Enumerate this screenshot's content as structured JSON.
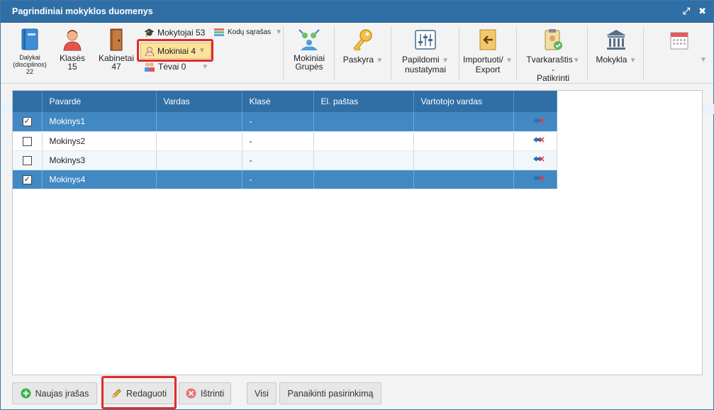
{
  "window": {
    "title": "Pagrindiniai mokyklos duomenys",
    "icons": [
      "resize-icon",
      "close-icon"
    ],
    "resize_glyph": "⤢",
    "close_glyph": "✖"
  },
  "ribbon": {
    "dalykai": {
      "label": "Dalykai (disciplinos)",
      "count": "22"
    },
    "klases": {
      "label": "Klasės",
      "count": "15"
    },
    "kabinetai": {
      "label": "Kabinetai",
      "count": "47"
    },
    "mokytojai": {
      "label": "Mokytojai 53"
    },
    "kodu": {
      "label": "Kodų sąrašas"
    },
    "mokiniai": {
      "label": "Mokiniai 4"
    },
    "tevai": {
      "label": "Tėvai 0"
    },
    "mokiniai_grupes": {
      "line1": "Mokiniai",
      "line2": "Grupės"
    },
    "paskyra": {
      "label": "Paskyra"
    },
    "papildomi": {
      "line1": "Papildomi",
      "line2": "nustatymai"
    },
    "import": {
      "line1": "Importuoti/",
      "line2": "Export"
    },
    "tvarkarastis": {
      "line1": "Tvarkaraštis",
      "line2": "-",
      "line3": "Patikrinti"
    },
    "mokykla": {
      "label": "Mokykla"
    },
    "dropdown_glyph": "▼"
  },
  "table": {
    "columns": [
      "Pavardė",
      "Vardas",
      "Klasė",
      "El. paštas",
      "Vartotojo vardas"
    ],
    "rows": [
      {
        "checked": true,
        "pavarde": "Mokinys1",
        "vardas": "",
        "klase": "-",
        "email": "",
        "username": ""
      },
      {
        "checked": false,
        "pavarde": "Mokinys2",
        "vardas": "",
        "klase": "-",
        "email": "",
        "username": ""
      },
      {
        "checked": false,
        "pavarde": "Mokinys3",
        "vardas": "",
        "klase": "-",
        "email": "",
        "username": ""
      },
      {
        "checked": true,
        "pavarde": "Mokinys4",
        "vardas": "",
        "klase": "-",
        "email": "",
        "username": ""
      }
    ],
    "check_glyph": "✓"
  },
  "buttons": {
    "new": "Naujas įrašas",
    "edit": "Redaguoti",
    "delete": "Ištrinti",
    "all": "Visi",
    "cancel_selection": "Panaikinti pasirinkimą"
  },
  "colors": {
    "header_blue": "#2f6fa6",
    "selected_row": "#4289c4",
    "highlight_red": "#e02b2b",
    "mokiniai_yellow": "#fbe39c"
  }
}
